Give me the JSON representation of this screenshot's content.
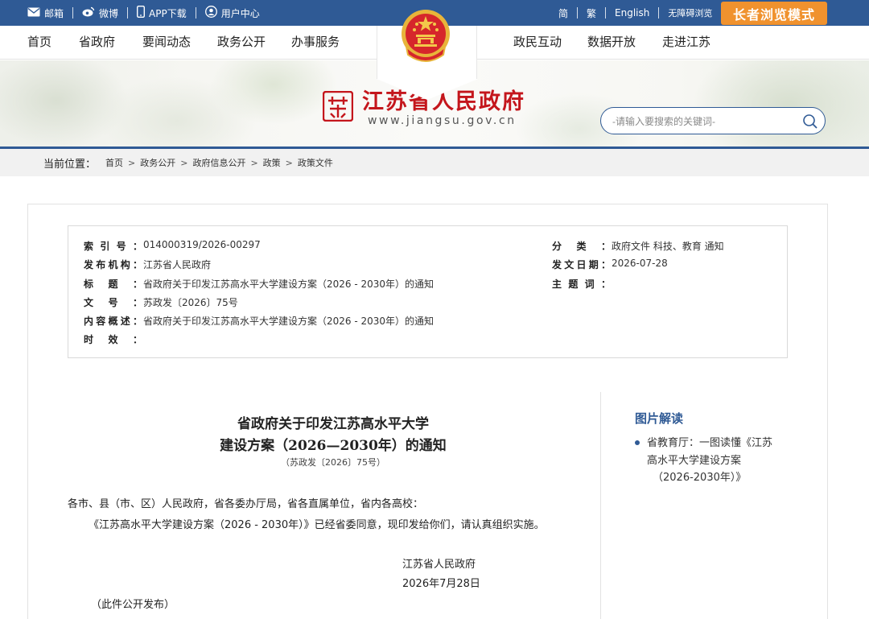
{
  "topbar": {
    "links": [
      "邮箱",
      "微博",
      "APP下载",
      "用户中心"
    ],
    "lang_links": [
      "简",
      "繁",
      "English",
      "无障碍浏览"
    ],
    "elder_mode": "长者浏览模式"
  },
  "nav": {
    "left": [
      "首页",
      "省政府",
      "要闻动态",
      "政务公开",
      "办事服务"
    ],
    "right": [
      "政民互动",
      "数据开放",
      "走进江苏"
    ]
  },
  "site": {
    "title": "江苏省人民政府",
    "url": "www.jiangsu.gov.cn",
    "search_placeholder": "-请输入要搜索的关键词-"
  },
  "breadcrumb": {
    "label": "当前位置：",
    "items": [
      "首页",
      "政务公开",
      "政府信息公开",
      "政策",
      "政策文件"
    ]
  },
  "meta": {
    "left": [
      {
        "key": "索引号：",
        "value": "014000319/2026-00297"
      },
      {
        "key": "发布机构：",
        "value": "江苏省人民政府"
      },
      {
        "key": "标题：",
        "value": "省政府关于印发江苏高水平大学建设方案（2026 - 2030年）的通知"
      },
      {
        "key": "文号：",
        "value": "苏政发〔2026〕75号"
      },
      {
        "key": "内容概述：",
        "value": "省政府关于印发江苏高水平大学建设方案（2026 - 2030年）的通知"
      },
      {
        "key": "时效：",
        "value": ""
      }
    ],
    "right": [
      {
        "key": "分类：",
        "value": "政府文件 科技、教育 通知"
      },
      {
        "key": "发文日期：",
        "value": "2026-07-28"
      },
      {
        "key": "主题词：",
        "value": ""
      }
    ]
  },
  "article": {
    "title_line1": "省政府关于印发江苏高水平大学",
    "title_line2": "建设方案（2026—2030年）的通知",
    "doc_no": "（苏政发〔2026〕75号）",
    "recipients": "各市、县（市、区）人民政府，省各委办厅局，省各直属单位，省内各高校：",
    "body": "《江苏高水平大学建设方案（2026 - 2030年）》已经省委同意，现印发给你们，请认真组织实施。",
    "signature": "江苏省人民政府",
    "date": "2026年7月28日",
    "note": "（此件公开发布）"
  },
  "sidebar": {
    "title": "图片解读",
    "item_line1": "省教育厅：一图读懂《江苏",
    "item_line2": "高水平大学建设方案",
    "item_line3": "（2026-2030年）》"
  },
  "colors": {
    "primary_blue": "#2f5a95",
    "elder_orange": "#f0922e",
    "title_red": "#c4161c"
  }
}
